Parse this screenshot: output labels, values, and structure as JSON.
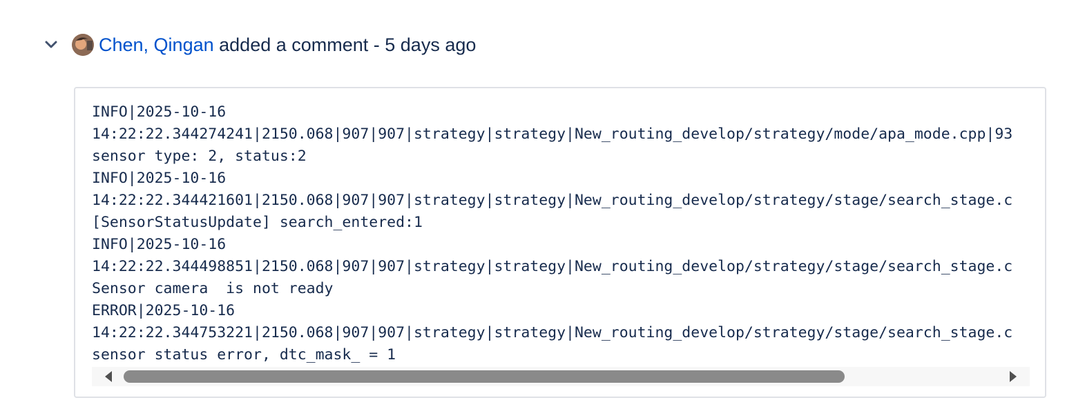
{
  "comment": {
    "author": "Chen, Qingan",
    "action_text": "added a comment - 5 days ago",
    "chevron_icon": "chevron-down-icon",
    "avatar_icon": "user-avatar"
  },
  "code_lines": [
    "INFO|2025-10-16",
    "14:22:22.344274241|2150.068|907|907|strategy|strategy|New_routing_develop/strategy/mode/apa_mode.cpp|93",
    "sensor type: 2, status:2",
    "INFO|2025-10-16",
    "14:22:22.344421601|2150.068|907|907|strategy|strategy|New_routing_develop/strategy/stage/search_stage.c",
    "[SensorStatusUpdate] search_entered:1",
    "INFO|2025-10-16",
    "14:22:22.344498851|2150.068|907|907|strategy|strategy|New_routing_develop/strategy/stage/search_stage.c",
    "Sensor camera  is not ready",
    "ERROR|2025-10-16",
    "14:22:22.344753221|2150.068|907|907|strategy|strategy|New_routing_develop/strategy/stage/search_stage.c",
    "sensor status error, dtc_mask_ = 1"
  ],
  "scrollbar": {
    "left_icon": "scroll-left-arrow-icon",
    "right_icon": "scroll-right-arrow-icon"
  }
}
